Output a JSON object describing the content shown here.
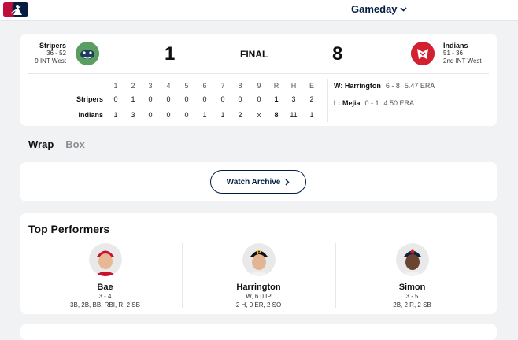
{
  "header": {
    "gameday_label": "Gameday"
  },
  "game": {
    "status": "FINAL",
    "away": {
      "name": "Stripers",
      "record": "36 - 52",
      "standing": "9 INT West",
      "score": "1",
      "color": "#5b9e62"
    },
    "home": {
      "name": "Indians",
      "record": "51 - 36",
      "standing": "2nd INT West",
      "score": "8",
      "color": "#d32030"
    }
  },
  "linescore": {
    "headers": [
      "1",
      "2",
      "3",
      "4",
      "5",
      "6",
      "7",
      "8",
      "9",
      "R",
      "H",
      "E"
    ],
    "rows": [
      {
        "team": "Stripers",
        "cells": [
          "0",
          "1",
          "0",
          "0",
          "0",
          "0",
          "0",
          "0",
          "0",
          "1",
          "3",
          "2"
        ]
      },
      {
        "team": "Indians",
        "cells": [
          "1",
          "3",
          "0",
          "0",
          "0",
          "1",
          "1",
          "2",
          "x",
          "8",
          "11",
          "1"
        ]
      }
    ]
  },
  "pitchers": {
    "win": {
      "label": "W: Harrington",
      "record": "6 - 8",
      "era": "5.47 ERA"
    },
    "loss": {
      "label": "L: Mejia",
      "record": "0 - 1",
      "era": "4.50 ERA"
    }
  },
  "tabs": [
    {
      "label": "Wrap"
    },
    {
      "label": "Box"
    }
  ],
  "archive": {
    "button_label": "Watch Archive"
  },
  "top_performers": {
    "title": "Top Performers",
    "players": [
      {
        "name": "Bae",
        "line1": "3 - 4",
        "line2": "3B, 2B, BB, RBI, R, 2 SB"
      },
      {
        "name": "Harrington",
        "line1": "W, 6.0 IP",
        "line2": "2 H, 0 ER, 2 SO"
      },
      {
        "name": "Simon",
        "line1": "3 - 5",
        "line2": "2B, 2 R, 2 SB"
      }
    ]
  }
}
